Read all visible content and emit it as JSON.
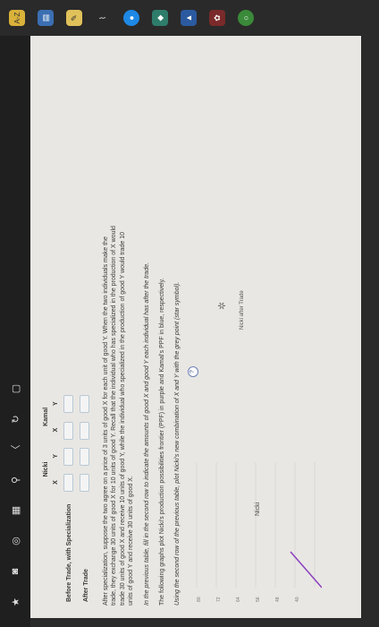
{
  "taskbar": {
    "icons": [
      "star-icon",
      "camera-icon",
      "circle-icon",
      "grid-icon",
      "pin-icon",
      "chat-icon",
      "refresh-icon",
      "box-icon"
    ]
  },
  "apps": {
    "icons": [
      "az-icon",
      "calendar-icon",
      "note-icon",
      "wifi-icon",
      "blue-icon",
      "chrome-icon",
      "shield-icon",
      "flower-icon",
      "circle-green-icon"
    ]
  },
  "table": {
    "group_headers": [
      "Nicki",
      "Kamal"
    ],
    "col_headers": [
      "X",
      "Y",
      "X",
      "Y"
    ],
    "rows": [
      {
        "label": "Before Trade, with Specialization"
      },
      {
        "label": "After Trade"
      }
    ]
  },
  "paragraph1": "After specialization, suppose the two agree on a price of 3 units of good X for each unit of good Y. When the two individuals make the trade, they exchange 30 units of good X for 10 units of good Y. Recall that the individual who has specialized in the production of X would trade 30 units of good X and receive 10 units of good Y, while the individual who specialized in the production of good Y would trade 10 units of good Y and receive 30 units of good X.",
  "instruction1": "In the previous table, fill in the second row to indicate the amounts of good X and good Y each individual has after the trade.",
  "instruction2": "The following graphs plot Nicki's production possibilities frontier (PPF) in purple and Kamal's PPF in blue, respectively.",
  "instruction3": "Using the second row of the previous table, plot Nicki's new combination of X and Y with the grey point (star symbol).",
  "graph": {
    "title": "Nicki",
    "legend_label": "Nicki after Trade",
    "help": "?",
    "y_ticks": [
      "80",
      "72",
      "64",
      "56",
      "48",
      "40"
    ],
    "ppf_color": "#8a3fbf"
  }
}
